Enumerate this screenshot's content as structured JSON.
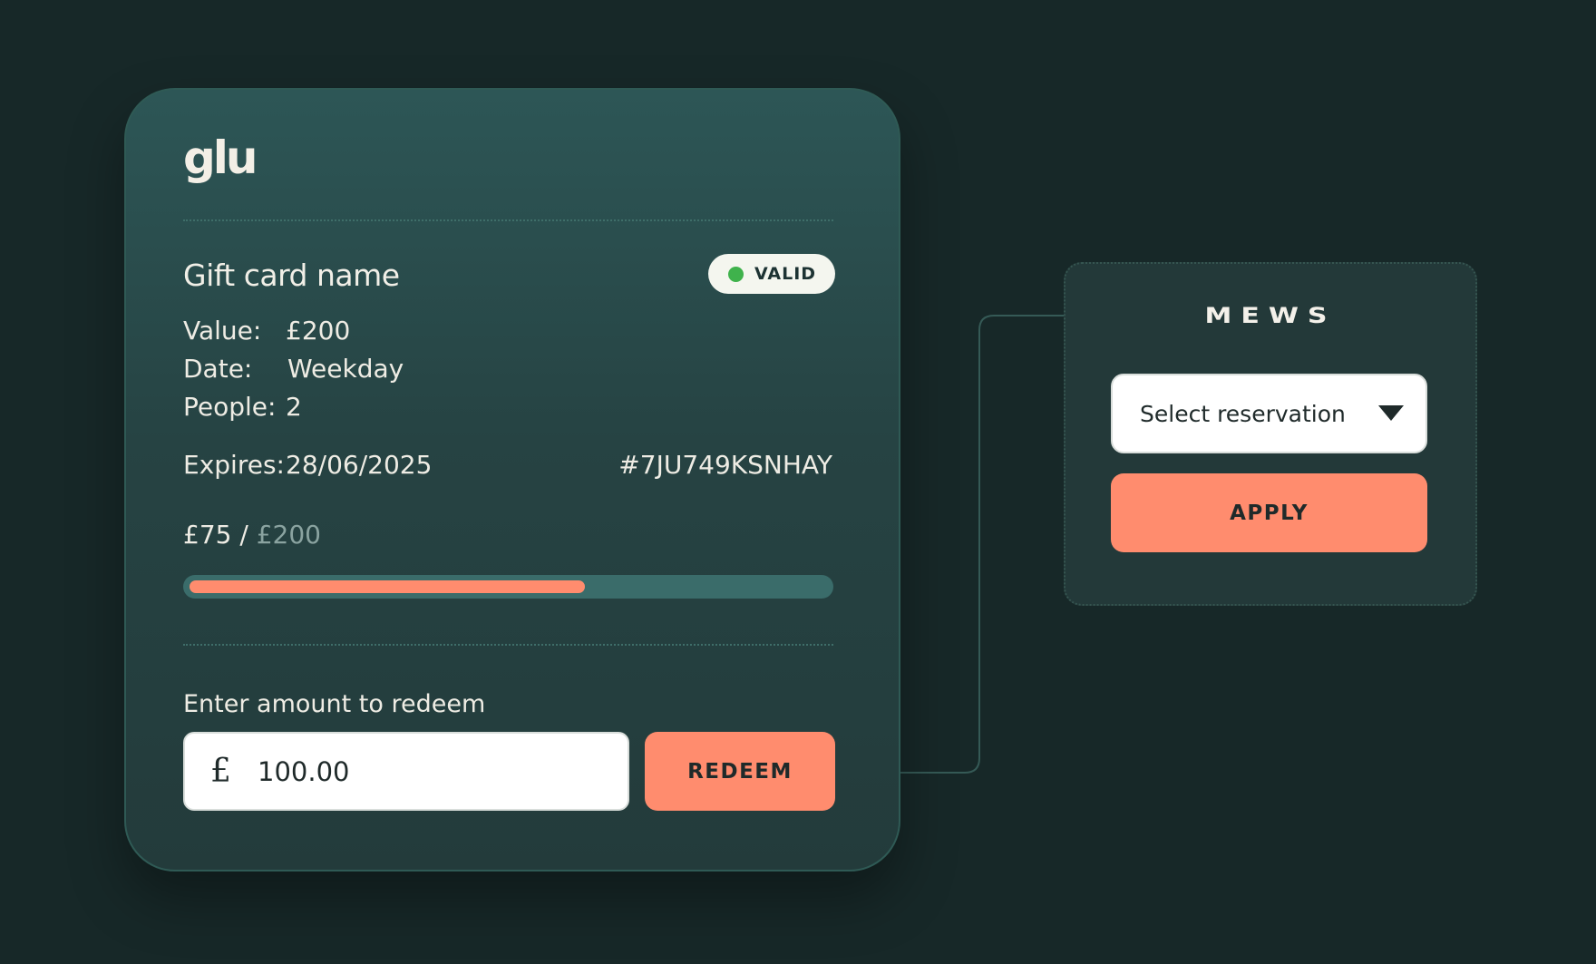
{
  "gift_card": {
    "brand": "glu",
    "name": "Gift card name",
    "status": "VALID",
    "status_color": "#3fb24c",
    "value_label": "Value:",
    "value": "£200",
    "date_label": "Date:",
    "date": "Weekday",
    "people_label": "People:",
    "people": "2",
    "expires_label": "Expires:",
    "expires": "28/06/2025",
    "code": "#7JU749KSNHAY",
    "balance_used": "£75",
    "balance_separator": " / ",
    "balance_total": "£200",
    "balance_progress_percent": 62
  },
  "redeem": {
    "label": "Enter amount to redeem",
    "currency_symbol": "£",
    "amount": "100.00",
    "button_label": "REDEEM"
  },
  "mews": {
    "brand": "MEWS",
    "select_label": "Select reservation",
    "apply_label": "APPLY"
  },
  "colors": {
    "accent": "#ff8c6e",
    "background": "#172828",
    "card": "#2d5656"
  }
}
